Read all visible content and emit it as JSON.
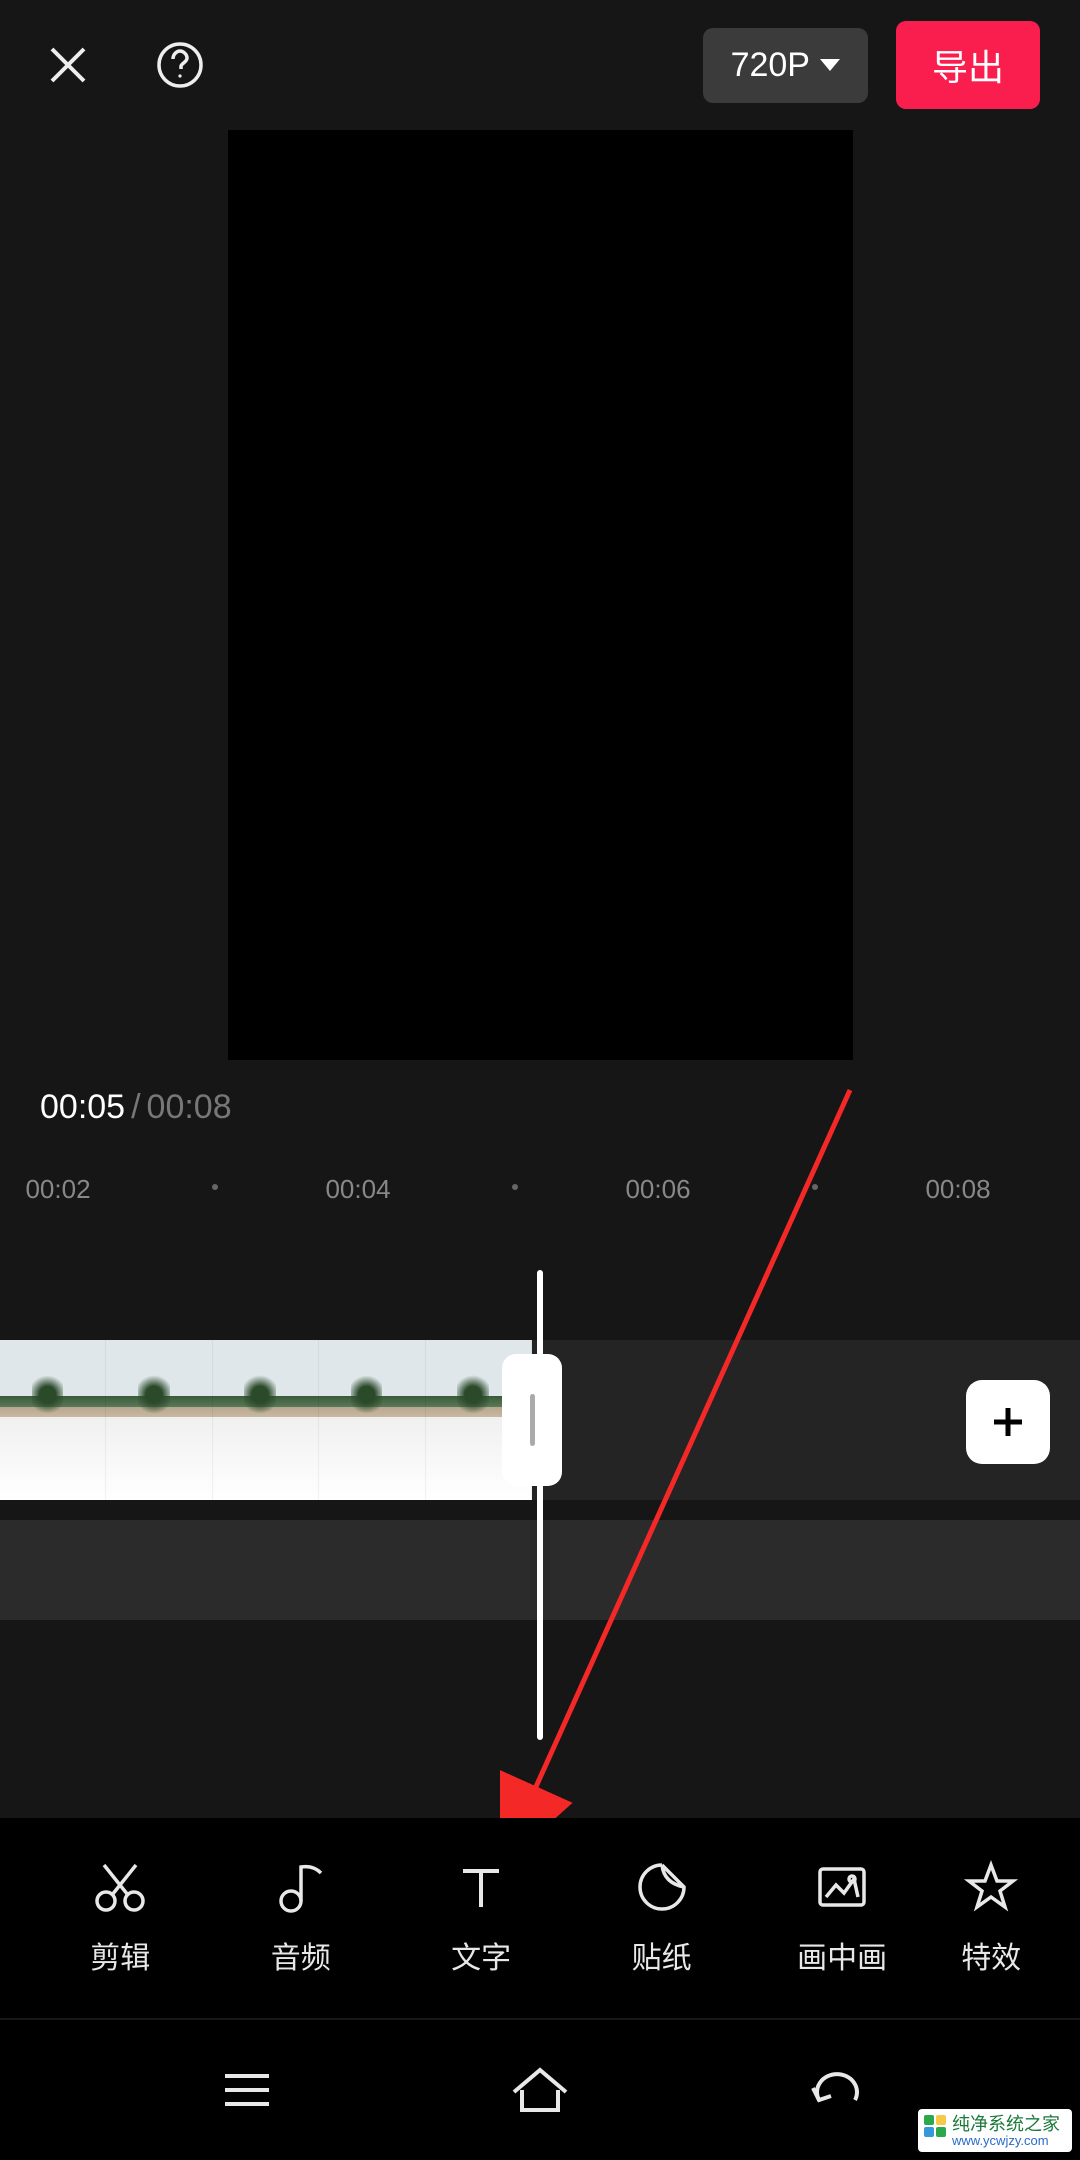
{
  "header": {
    "resolution_label": "720P",
    "export_label": "导出"
  },
  "playback": {
    "current_time": "00:05",
    "separator": "/",
    "total_time": "00:08"
  },
  "ruler": {
    "t1": "00:02",
    "t2": "00:04",
    "t3": "00:06",
    "t4": "00:08"
  },
  "tools": {
    "edit": "剪辑",
    "audio": "音频",
    "text": "文字",
    "sticker": "贴纸",
    "pip": "画中画",
    "effect": "特效"
  },
  "watermark": {
    "title": "纯净系统之家",
    "url": "www.ycwjzy.com"
  }
}
